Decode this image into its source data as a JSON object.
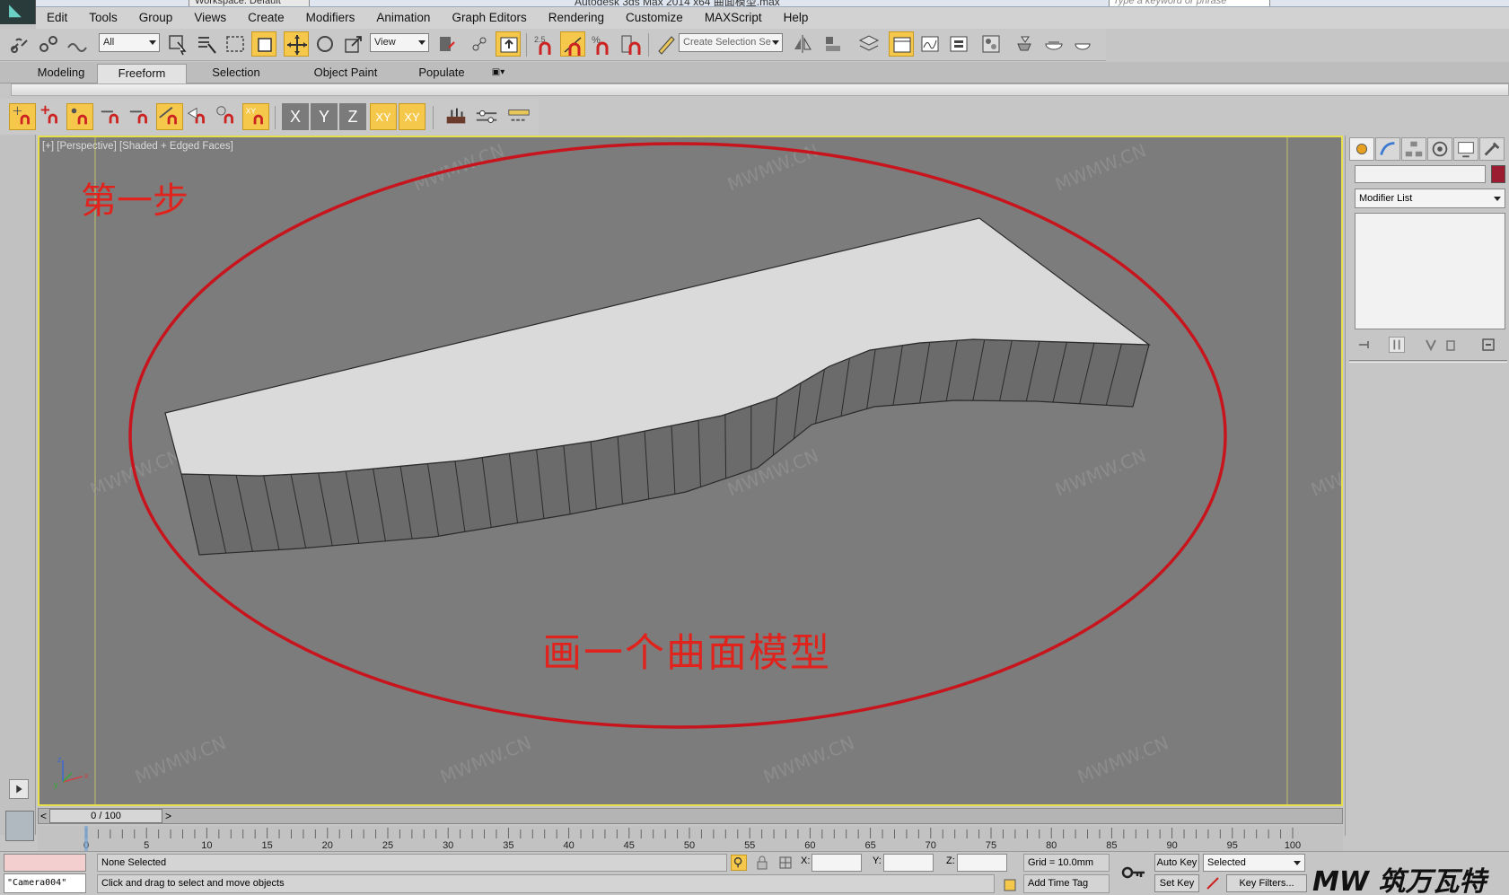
{
  "window": {
    "workspace": "Workspace: Default",
    "title": "Autodesk 3ds Max  2014 x64    曲面模型.max",
    "search_placeholder": "Type a keyword or phrase"
  },
  "menu": [
    "Edit",
    "Tools",
    "Group",
    "Views",
    "Create",
    "Modifiers",
    "Animation",
    "Graph Editors",
    "Rendering",
    "Customize",
    "MAXScript",
    "Help"
  ],
  "toolbar": {
    "selection_filter": "All",
    "reference_coord": "View",
    "named_selection": "Create Selection Se"
  },
  "ribbon_tabs": [
    {
      "label": "Modeling",
      "active": false
    },
    {
      "label": "Freeform",
      "active": true
    },
    {
      "label": "Selection",
      "active": false
    },
    {
      "label": "Object Paint",
      "active": false
    },
    {
      "label": "Populate",
      "active": false
    }
  ],
  "snaps": {
    "axes": [
      "X",
      "Y",
      "Z"
    ],
    "plane_xy": "XY",
    "plane_xy2": "XY"
  },
  "viewport": {
    "label": "[+] [Perspective] [Shaded + Edged Faces]",
    "annotation_step": "第一步",
    "annotation_caption": "画一个曲面模型",
    "watermark": "MWMW.CN",
    "annotation_color": "#e0231d",
    "border_color": "#e7e04b"
  },
  "command_panel": {
    "modifier_list": "Modifier List",
    "object_color": "#9b1b30"
  },
  "timeline": {
    "frame_display": "0 / 100",
    "prev": "<",
    "next": ">",
    "tick_labels": [
      "0",
      "5",
      "10",
      "15",
      "20",
      "25",
      "30",
      "35",
      "40",
      "45",
      "50",
      "55",
      "60",
      "65",
      "70",
      "75",
      "80",
      "85",
      "90",
      "95",
      "100"
    ]
  },
  "status": {
    "maxscript_listener": "\"Camera004\"",
    "selection": "None Selected",
    "prompt": "Click and drag to select and move objects",
    "x_label": "X:",
    "y_label": "Y:",
    "z_label": "Z:",
    "grid": "Grid = 10.0mm",
    "add_time_tag": "Add Time Tag",
    "auto_key": "Auto Key",
    "set_key": "Set Key",
    "key_mode": "Selected",
    "key_filters": "Key Filters..."
  },
  "brand_logo": "MW 筑万瓦特"
}
